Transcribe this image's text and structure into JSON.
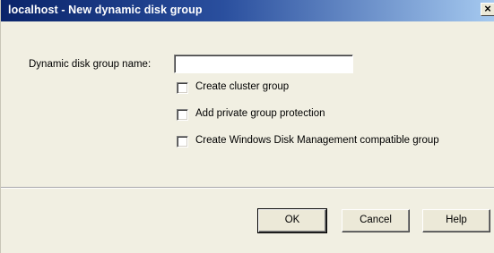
{
  "window": {
    "title": "localhost - New dynamic disk group",
    "close_glyph": "✕"
  },
  "form": {
    "name_label": "Dynamic disk group name:",
    "name_value": "",
    "name_placeholder": ""
  },
  "options": [
    {
      "label": "Create cluster group",
      "checked": false
    },
    {
      "label": "Add private group protection",
      "checked": false
    },
    {
      "label": "Create Windows Disk Management compatible group",
      "checked": false
    }
  ],
  "buttons": {
    "ok_label": "OK",
    "cancel_label": "Cancel",
    "help_label": "Help"
  }
}
